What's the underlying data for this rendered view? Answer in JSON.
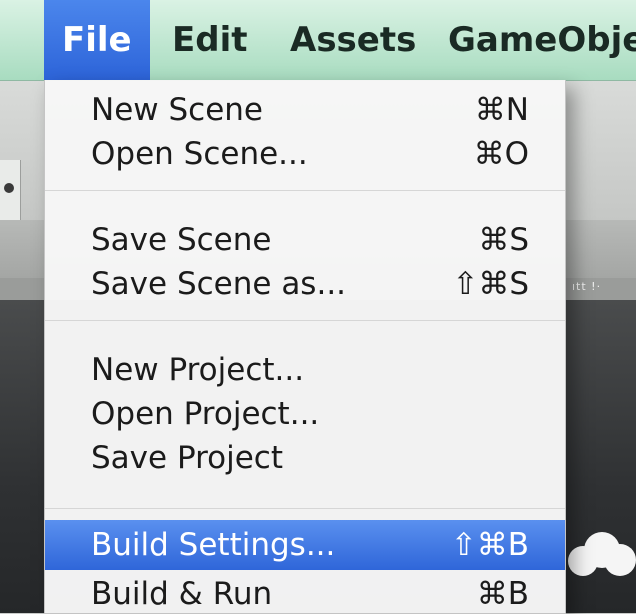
{
  "menubar": {
    "items": [
      "File",
      "Edit",
      "Assets",
      "GameObje"
    ],
    "active_index": 0
  },
  "file_menu": {
    "groups": [
      [
        {
          "label": "New Scene",
          "shortcut": "⌘N"
        },
        {
          "label": "Open Scene...",
          "shortcut": "⌘O"
        }
      ],
      [
        {
          "label": "Save Scene",
          "shortcut": "⌘S"
        },
        {
          "label": "Save Scene as...",
          "shortcut": "⇧⌘S"
        }
      ],
      [
        {
          "label": "New Project...",
          "shortcut": ""
        },
        {
          "label": "Open Project...",
          "shortcut": ""
        },
        {
          "label": "Save Project",
          "shortcut": ""
        }
      ],
      [
        {
          "label": "Build Settings...",
          "shortcut": "⇧⌘B",
          "highlighted": true
        },
        {
          "label": "Build & Run",
          "shortcut": "⌘B"
        }
      ]
    ]
  },
  "colors": {
    "menubar_bg": "#bfe6d0",
    "highlight": "#3a74e3",
    "menu_bg": "#f6f6f6",
    "scene_bg": "#2f3133"
  }
}
